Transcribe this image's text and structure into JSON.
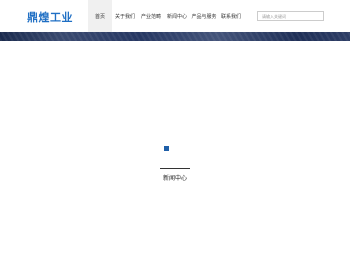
{
  "header": {
    "logo_text": "鼎煌工业",
    "nav": [
      {
        "label": "首页",
        "active": true
      },
      {
        "label": "关于我们",
        "active": false
      },
      {
        "label": "产业范畴",
        "active": false
      },
      {
        "label": "新闻中心",
        "active": false
      },
      {
        "label": "产品与服务",
        "active": false
      },
      {
        "label": "联系我们",
        "active": false
      }
    ],
    "search_placeholder": "请输入关键词"
  },
  "content": {
    "section_title": "新闻中心"
  },
  "colors": {
    "brand": "#1f6fc4",
    "marker": "#1f5fa8",
    "banner": "#263762"
  }
}
